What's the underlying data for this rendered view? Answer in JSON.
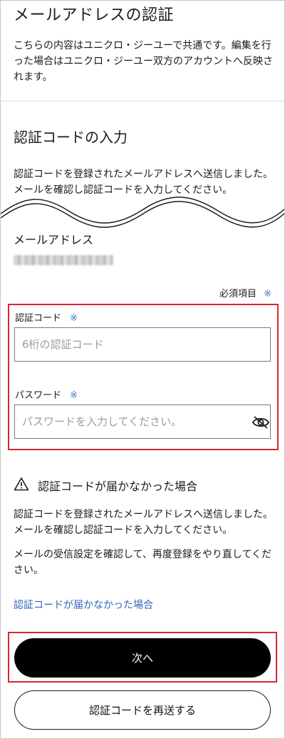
{
  "header": {
    "title": "メールアドレスの認証",
    "intro": "こちらの内容はユニクロ・ジーユーで共通です。編集を行った場合はユニクロ・ジーユー双方のアカウントへ反映されます。"
  },
  "code_section": {
    "title": "認証コードの入力",
    "description": "認証コードを登録されたメールアドレスへ送信しました。メールを確認し認証コードを入力してください。"
  },
  "email": {
    "label": "メールアドレス"
  },
  "required_note": {
    "label": "必須項目",
    "mark": "※"
  },
  "form": {
    "code_label": "認証コード",
    "code_placeholder": "6桁の認証コード",
    "code_value": "",
    "password_label": "パスワード",
    "password_placeholder": "パスワードを入力してください。",
    "password_value": "",
    "required_mark": "※",
    "toggle_icon": "eye-slash-icon"
  },
  "help": {
    "icon": "warning-triangle-icon",
    "title": "認証コードが届かなかった場合",
    "description": "認証コードを登録されたメールアドレスへ送信しました。メールを確認し認証コードを入力してください。",
    "description2": "メールの受信設定を確認して、再度登録をやり直してください。",
    "link": "認証コードが届かなかった場合"
  },
  "actions": {
    "next": "次へ",
    "resend": "認証コードを再送する"
  },
  "colors": {
    "accent_link": "#2f66b8",
    "required_mark": "#3a73c9",
    "highlight_border": "#d9272e",
    "primary_button": "#000000"
  }
}
